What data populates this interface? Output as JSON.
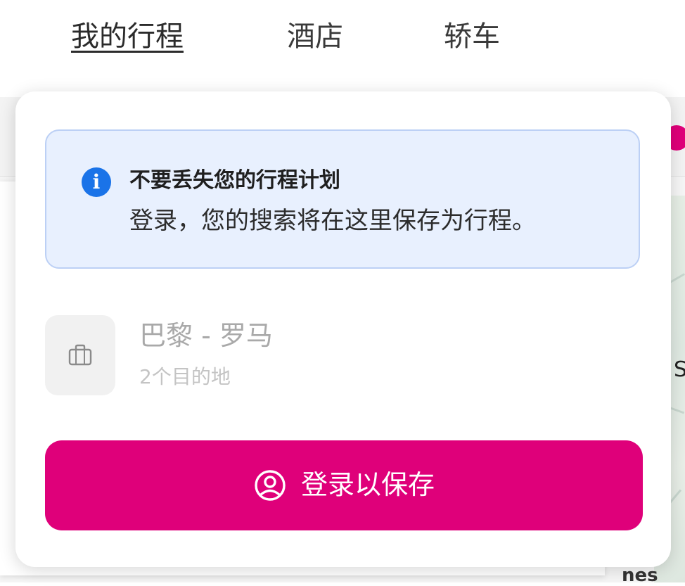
{
  "nav": {
    "tabs": [
      {
        "label": "我的行程",
        "active": true
      },
      {
        "label": "酒店",
        "active": false
      },
      {
        "label": "轿车",
        "active": false
      }
    ]
  },
  "popover": {
    "info": {
      "icon": "info-icon",
      "title": "不要丢失您的行程计划",
      "body": "登录，您的搜索将在这里保存为行程。"
    },
    "trip": {
      "icon": "suitcase-icon",
      "name": "巴黎 - 罗马",
      "subtitle": "2个目的地"
    },
    "login_button": {
      "icon": "user-circle-icon",
      "label": "登录以保存"
    }
  },
  "background": {
    "map_label": "nes",
    "map_letter": "S"
  },
  "colors": {
    "brand": "#df007a",
    "info_bg": "#e8f0fe",
    "info_border": "#bcd0f5",
    "info_icon": "#1a73e8",
    "muted_text": "#a9a9a9"
  }
}
